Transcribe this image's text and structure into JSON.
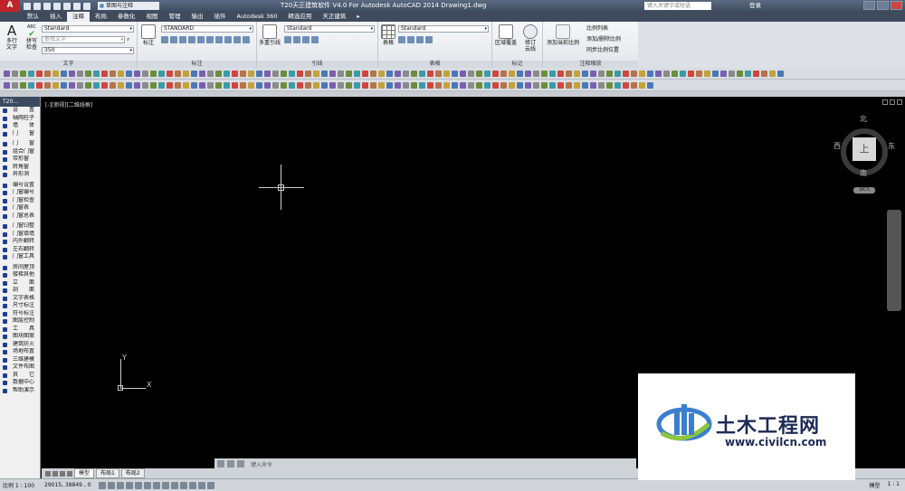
{
  "title_bar": {
    "logo": "A",
    "workspace": "草图与注释",
    "title": "T20天正建筑软件 V4.0 For Autodesk AutoCAD 2014   Drawing1.dwg",
    "search_placeholder": "键入关键字或短语",
    "login": "登录"
  },
  "tabs": [
    "默认",
    "插入",
    "注释",
    "布局",
    "参数化",
    "视图",
    "管理",
    "输出",
    "插件",
    "Autodesk 360",
    "精选应用",
    "天正建筑",
    "▸"
  ],
  "ribbon": {
    "text_panel": {
      "multiline_text": "多行文字",
      "spell_check": "拼写检查",
      "style": "Standard",
      "find_text": "查找文字",
      "height": "350",
      "title": "文字"
    },
    "dim_panel": {
      "dimension": "标注",
      "style": "STANDARD",
      "title": "标注"
    },
    "leader_panel": {
      "multileader": "多重引线",
      "style": "Standard",
      "title": "引线"
    },
    "table_panel": {
      "table": "表格",
      "style": "Standard",
      "title": "表格"
    },
    "markup_panel": {
      "wipeout": "区域覆盖",
      "revcloud": "修订云线",
      "title": "标记"
    },
    "scale_panel": {
      "add_current": "添加当前比例",
      "scale_list": "比例列表",
      "add_delete": "添加/删除比例",
      "sync": "同步比例位置",
      "title": "注释缩放"
    }
  },
  "palette": {
    "header": "T20...",
    "items": [
      "设　　置",
      "轴网柱子",
      "墙　　体",
      "门　　窗",
      "门　　窗",
      "组合门窗",
      "带形窗",
      "转角窗",
      "异形洞",
      "编号设置",
      "门窗编号",
      "门窗检查",
      "门窗表",
      "门窗总表",
      "门窗归整",
      "门窗填墙",
      "内外翻转",
      "左右翻转",
      "门窗工具",
      "房间屋顶",
      "楼梯其他",
      "立　　面",
      "剖　　面",
      "文字表格",
      "尺寸标注",
      "符号标注",
      "图层控制",
      "工　　具",
      "图块图案",
      "建筑防火",
      "场地布置",
      "三维建模",
      "文件布图",
      "其　　它",
      "数据中心",
      "帮助演示"
    ]
  },
  "viewport": {
    "label": "[-][俯视][二维线框]",
    "ucs_x": "X",
    "ucs_y": "Y"
  },
  "viewcube": {
    "north": "北",
    "south": "南",
    "east": "东",
    "west": "西",
    "face": "上",
    "wcs": "WCS"
  },
  "command": {
    "placeholder": "键入命令"
  },
  "layout_tabs": [
    "模型",
    "布局1",
    "布局2"
  ],
  "status": {
    "scale": "比例 1 : 100",
    "coords": "29015, 38849 , 0",
    "model": "模型",
    "anno_scale": "1 : 1"
  },
  "watermark": {
    "name": "土木工程网",
    "url": "www.civilcn.com"
  },
  "colors": {
    "accent": "#c0242a",
    "palette_icon": "#1d3e9c",
    "watermark_text": "#1d2a55",
    "watermark_blue": "#3a7fd0",
    "watermark_green": "#8cc63f"
  }
}
